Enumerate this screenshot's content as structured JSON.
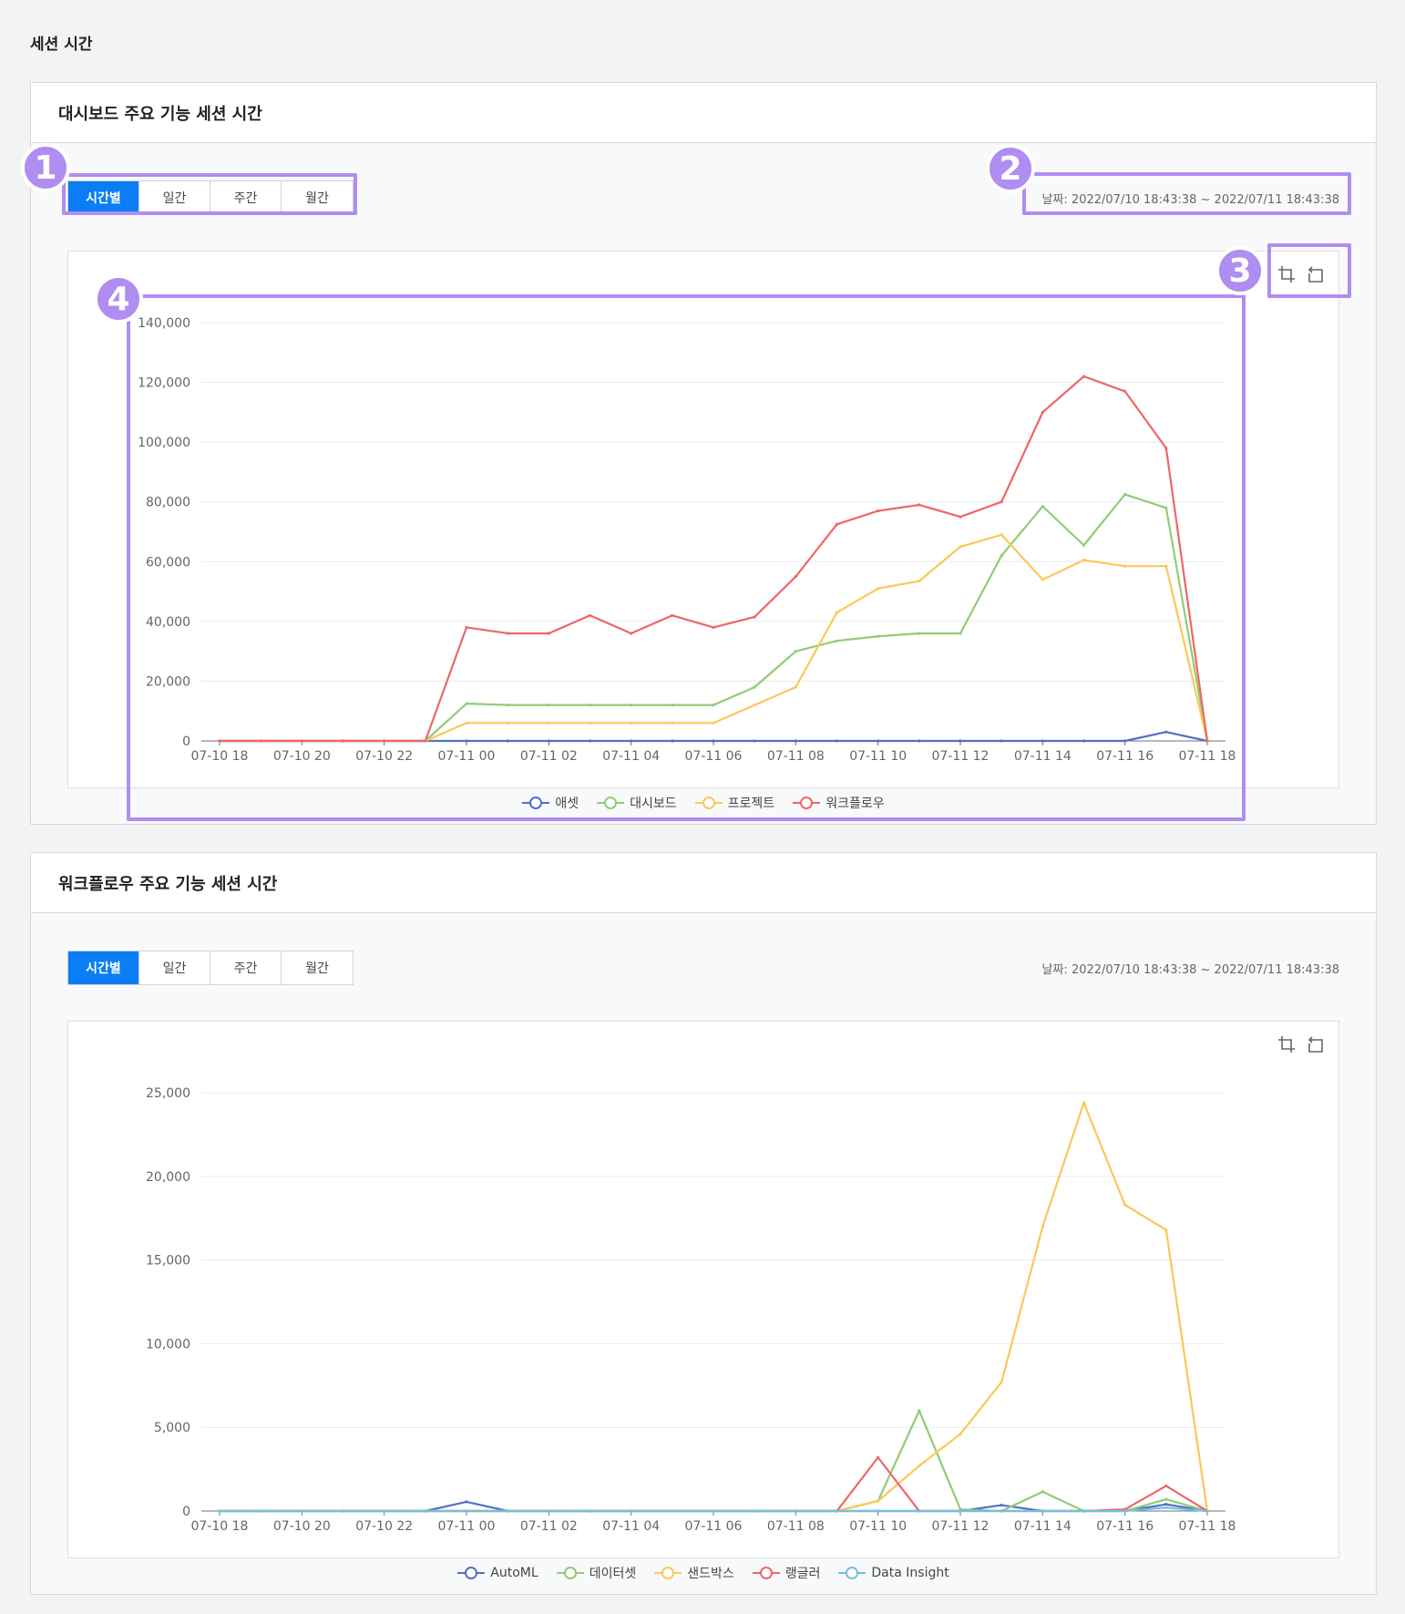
{
  "page_title": "세션 시간",
  "tabs": [
    "시간별",
    "일간",
    "주간",
    "월간"
  ],
  "date_range": "날짜: 2022/07/10 18:43:38 ~ 2022/07/11 18:43:38",
  "annotations": [
    "1",
    "2",
    "3",
    "4"
  ],
  "tool_icons": [
    "zoom-icon",
    "restore-icon"
  ],
  "panels": [
    {
      "title": "대시보드 주요 기능 세션 시간",
      "chart_data": {
        "type": "line",
        "x": [
          "07-10 18",
          "07-10 19",
          "07-10 20",
          "07-10 21",
          "07-10 22",
          "07-10 23",
          "07-11 00",
          "07-11 01",
          "07-11 02",
          "07-11 03",
          "07-11 04",
          "07-11 05",
          "07-11 06",
          "07-11 07",
          "07-11 08",
          "07-11 09",
          "07-11 10",
          "07-11 11",
          "07-11 12",
          "07-11 13",
          "07-11 14",
          "07-11 15",
          "07-11 16",
          "07-11 17",
          "07-11 18"
        ],
        "xticks": [
          "07-10 18",
          "07-10 20",
          "07-10 22",
          "07-11 00",
          "07-11 02",
          "07-11 04",
          "07-11 06",
          "07-11 08",
          "07-11 10",
          "07-11 12",
          "07-11 14",
          "07-11 16",
          "07-11 18"
        ],
        "yticks": [
          "0",
          "20,000",
          "40,000",
          "60,000",
          "80,000",
          "100,000",
          "120,000",
          "140,000"
        ],
        "ylim": [
          0,
          140000
        ],
        "series": [
          {
            "name": "애셋",
            "color": "#5470c6",
            "values": [
              0,
              0,
              0,
              0,
              0,
              0,
              0,
              0,
              0,
              0,
              0,
              0,
              0,
              0,
              0,
              0,
              0,
              0,
              0,
              0,
              0,
              0,
              0,
              3000,
              0
            ]
          },
          {
            "name": "대시보드",
            "color": "#91cc75",
            "values": [
              0,
              0,
              0,
              0,
              0,
              0,
              12500,
              12000,
              12000,
              12000,
              12000,
              12000,
              12000,
              18000,
              30000,
              33500,
              35000,
              36000,
              36000,
              62000,
              78500,
              65500,
              82500,
              78000,
              0
            ]
          },
          {
            "name": "프로젝트",
            "color": "#fac858",
            "values": [
              0,
              0,
              0,
              0,
              0,
              0,
              6000,
              6000,
              6000,
              6000,
              6000,
              6000,
              6000,
              12000,
              18000,
              43000,
              51000,
              53500,
              65000,
              69000,
              54000,
              60500,
              58500,
              58500,
              0
            ]
          },
          {
            "name": "워크플로우",
            "color": "#ee6666",
            "values": [
              0,
              0,
              0,
              0,
              0,
              0,
              38000,
              36000,
              36000,
              42000,
              36000,
              42000,
              38000,
              41500,
              55000,
              72500,
              77000,
              79000,
              75000,
              80000,
              110000,
              122000,
              117000,
              98000,
              0
            ]
          }
        ]
      }
    },
    {
      "title": "워크플로우 주요 기능 세션 시간",
      "chart_data": {
        "type": "line",
        "x": [
          "07-10 18",
          "07-10 19",
          "07-10 20",
          "07-10 21",
          "07-10 22",
          "07-10 23",
          "07-11 00",
          "07-11 01",
          "07-11 02",
          "07-11 03",
          "07-11 04",
          "07-11 05",
          "07-11 06",
          "07-11 07",
          "07-11 08",
          "07-11 09",
          "07-11 10",
          "07-11 11",
          "07-11 12",
          "07-11 13",
          "07-11 14",
          "07-11 15",
          "07-11 16",
          "07-11 17",
          "07-11 18"
        ],
        "xticks": [
          "07-10 18",
          "07-10 20",
          "07-10 22",
          "07-11 00",
          "07-11 02",
          "07-11 04",
          "07-11 06",
          "07-11 08",
          "07-11 10",
          "07-11 12",
          "07-11 14",
          "07-11 16",
          "07-11 18"
        ],
        "yticks": [
          "0",
          "5,000",
          "10,000",
          "15,000",
          "20,000",
          "25,000"
        ],
        "ylim": [
          0,
          25000
        ],
        "series": [
          {
            "name": "AutoML",
            "color": "#5470c6",
            "values": [
              0,
              0,
              0,
              0,
              0,
              0,
              550,
              0,
              0,
              0,
              0,
              0,
              0,
              0,
              0,
              0,
              0,
              0,
              0,
              350,
              0,
              0,
              0,
              400,
              0
            ]
          },
          {
            "name": "데이터셋",
            "color": "#91cc75",
            "values": [
              0,
              0,
              0,
              0,
              0,
              0,
              0,
              0,
              0,
              0,
              0,
              0,
              0,
              0,
              0,
              0,
              600,
              6000,
              100,
              0,
              1150,
              0,
              0,
              700,
              0
            ]
          },
          {
            "name": "샌드박스",
            "color": "#fac858",
            "values": [
              0,
              0,
              0,
              0,
              0,
              0,
              0,
              0,
              0,
              0,
              0,
              0,
              0,
              0,
              0,
              0,
              600,
              2700,
              4600,
              7700,
              17000,
              24400,
              18300,
              16800,
              0
            ]
          },
          {
            "name": "랭글러",
            "color": "#ee6666",
            "values": [
              0,
              0,
              0,
              0,
              0,
              0,
              0,
              0,
              0,
              0,
              0,
              0,
              0,
              0,
              0,
              0,
              3200,
              0,
              0,
              0,
              0,
              0,
              100,
              1500,
              0
            ]
          },
          {
            "name": "Data Insight",
            "color": "#73c0de",
            "values": [
              0,
              0,
              0,
              0,
              0,
              0,
              0,
              0,
              0,
              0,
              0,
              0,
              0,
              0,
              0,
              0,
              0,
              0,
              0,
              0,
              0,
              0,
              0,
              200,
              0
            ]
          }
        ]
      }
    }
  ]
}
